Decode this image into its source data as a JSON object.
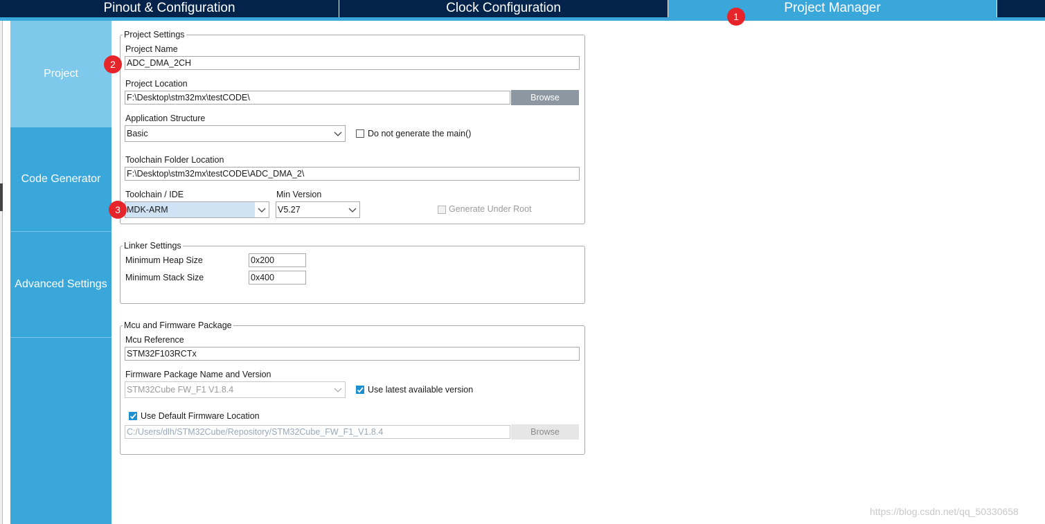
{
  "tabs": {
    "pinout": "Pinout & Configuration",
    "clock": "Clock Configuration",
    "project_manager": "Project Manager"
  },
  "sidebar": {
    "items": [
      "Project",
      "Code Generator",
      "Advanced Settings"
    ],
    "active": "Project"
  },
  "project_settings": {
    "legend": "Project Settings",
    "project_name_label": "Project Name",
    "project_name_value": "ADC_DMA_2CH",
    "project_location_label": "Project Location",
    "project_location_value": "F:\\Desktop\\stm32mx\\testCODE\\",
    "browse_label": "Browse",
    "app_structure_label": "Application Structure",
    "app_structure_value": "Basic",
    "do_not_generate_main_label": "Do not generate the main()",
    "do_not_generate_main_checked": false,
    "toolchain_folder_label": "Toolchain Folder Location",
    "toolchain_folder_value": "F:\\Desktop\\stm32mx\\testCODE\\ADC_DMA_2\\",
    "toolchain_label": "Toolchain / IDE",
    "toolchain_value": "MDK-ARM",
    "min_version_label": "Min Version",
    "min_version_value": "V5.27",
    "generate_under_root_label": "Generate Under Root",
    "generate_under_root_checked": false
  },
  "linker_settings": {
    "legend": "Linker Settings",
    "heap_label": "Minimum Heap Size",
    "heap_value": "0x200",
    "stack_label": "Minimum Stack Size",
    "stack_value": "0x400"
  },
  "mcu_firmware": {
    "legend": "Mcu and Firmware Package",
    "mcu_ref_label": "Mcu Reference",
    "mcu_ref_value": "STM32F103RCTx",
    "fw_label": "Firmware Package Name and Version",
    "fw_value": "STM32Cube FW_F1 V1.8.4",
    "use_latest_label": "Use latest available version",
    "use_latest_checked": true,
    "use_default_location_label": "Use Default Firmware Location",
    "use_default_location_checked": true,
    "fw_location_value": "C:/Users/dlh/STM32Cube/Repository/STM32Cube_FW_F1_V1.8.4",
    "browse_label": "Browse"
  },
  "annotations": [
    "1",
    "2",
    "3"
  ],
  "watermark": "https://blog.csdn.net/qq_50330658",
  "colors": {
    "tabbar": "#03234b",
    "accent": "#3aa7db",
    "sidebar_active": "#7ec8eb",
    "badge": "#e5252a",
    "checkbox": "#1e90d2"
  }
}
